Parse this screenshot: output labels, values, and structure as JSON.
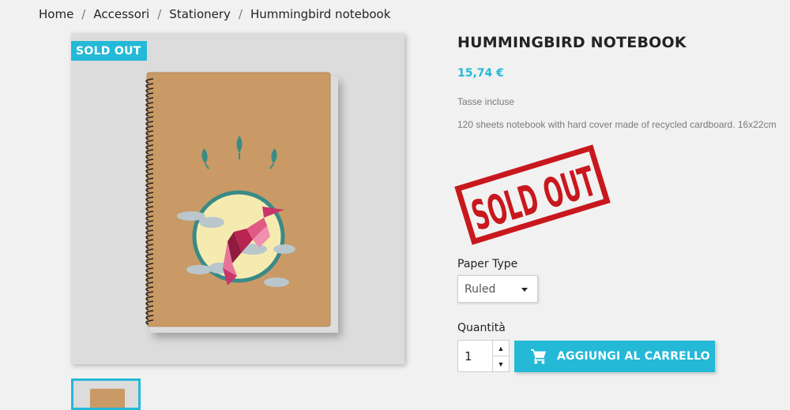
{
  "breadcrumb": {
    "items": [
      "Home",
      "Accessori",
      "Stationery",
      "Hummingbird notebook"
    ],
    "separator": "/"
  },
  "product": {
    "flag": "SOLD OUT",
    "title": "HUMMINGBIRD NOTEBOOK",
    "price": "15,74 €",
    "tax_note": "Tasse incluse",
    "description": "120 sheets notebook with hard cover made of recycled cardboard. 16x22cm",
    "stamp_text": "SOLD OUT"
  },
  "variant": {
    "label": "Paper Type",
    "selected": "Ruled"
  },
  "quantity": {
    "label": "Quantità",
    "value": "1"
  },
  "cart_button": {
    "label": "AGGIUNGI AL CARRELLO",
    "icon": "cart-icon"
  },
  "colors": {
    "accent": "#24b9d7",
    "stamp_red": "#c8181e",
    "background": "#f1f1f1"
  }
}
